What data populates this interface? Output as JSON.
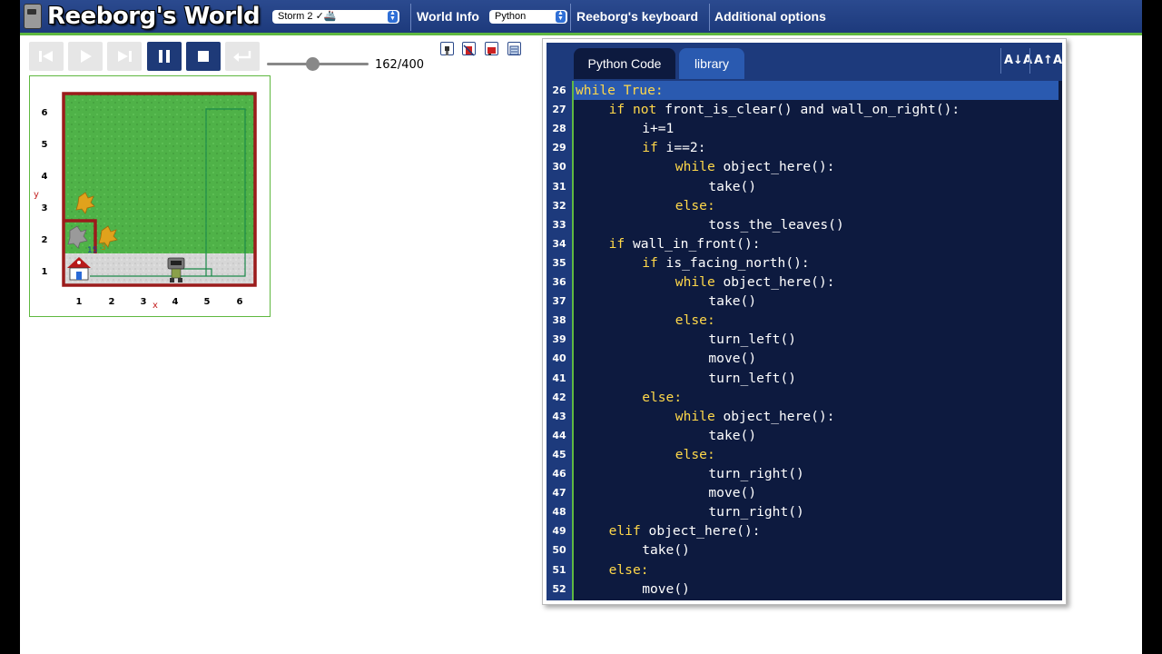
{
  "header": {
    "app_title": "Reeborg's World",
    "world_select": "Storm 2 ✓🚢",
    "world_info": "World Info",
    "language_select": "Python",
    "keyboard": "Reeborg's keyboard",
    "additional": "Additional options"
  },
  "controls": {
    "reverse_step": "reverse-step-icon",
    "run": "play-icon",
    "step": "step-icon",
    "pause": "pause-icon",
    "stop": "stop-icon",
    "reload": "reload-icon",
    "speed_percent": 45,
    "steps": "162/400",
    "toolbar_icons": [
      "robot-model-icon",
      "highlight-toggle-icon",
      "watch-variables-icon",
      "world-editor-icon"
    ]
  },
  "world": {
    "x_ticks": [
      "1",
      "2",
      "3",
      "4",
      "5",
      "6"
    ],
    "y_ticks": [
      "1",
      "2",
      "3",
      "4",
      "5",
      "6"
    ],
    "x_label": "x",
    "y_label": "y",
    "colors": {
      "wall": "#9b1b1b",
      "grass": "#4fb248",
      "trace": "#1c8a4a"
    },
    "leaf_count_1": "15",
    "leaf_count_2": "3"
  },
  "editor": {
    "tabs": [
      "Python Code",
      "library"
    ],
    "font_decrease": "A↓A",
    "font_increase": "A↑A",
    "highlight_line": 26,
    "lines": [
      {
        "n": "26",
        "indent": 0,
        "kw": "while True:",
        "rest": ""
      },
      {
        "n": "27",
        "indent": 1,
        "kw": "if not",
        "rest": " front_is_clear() and wall_on_right():"
      },
      {
        "n": "28",
        "indent": 2,
        "kw": "",
        "rest": "i+=1"
      },
      {
        "n": "29",
        "indent": 2,
        "kw": "if",
        "rest": " i==2:"
      },
      {
        "n": "30",
        "indent": 3,
        "kw": "while",
        "rest": " object_here():"
      },
      {
        "n": "31",
        "indent": 4,
        "kw": "",
        "rest": "take()"
      },
      {
        "n": "32",
        "indent": 3,
        "kw": "else:",
        "rest": ""
      },
      {
        "n": "33",
        "indent": 4,
        "kw": "",
        "rest": "toss_the_leaves()"
      },
      {
        "n": "34",
        "indent": 1,
        "kw": "if",
        "rest": " wall_in_front():"
      },
      {
        "n": "35",
        "indent": 2,
        "kw": "if",
        "rest": " is_facing_north():"
      },
      {
        "n": "36",
        "indent": 3,
        "kw": "while",
        "rest": " object_here():"
      },
      {
        "n": "37",
        "indent": 4,
        "kw": "",
        "rest": "take()"
      },
      {
        "n": "38",
        "indent": 3,
        "kw": "else:",
        "rest": ""
      },
      {
        "n": "39",
        "indent": 4,
        "kw": "",
        "rest": "turn_left()"
      },
      {
        "n": "40",
        "indent": 4,
        "kw": "",
        "rest": "move()"
      },
      {
        "n": "41",
        "indent": 4,
        "kw": "",
        "rest": "turn_left()"
      },
      {
        "n": "42",
        "indent": 2,
        "kw": "else:",
        "rest": ""
      },
      {
        "n": "43",
        "indent": 3,
        "kw": "while",
        "rest": " object_here():"
      },
      {
        "n": "44",
        "indent": 4,
        "kw": "",
        "rest": "take()"
      },
      {
        "n": "45",
        "indent": 3,
        "kw": "else:",
        "rest": ""
      },
      {
        "n": "46",
        "indent": 4,
        "kw": "",
        "rest": "turn_right()"
      },
      {
        "n": "47",
        "indent": 4,
        "kw": "",
        "rest": "move()"
      },
      {
        "n": "48",
        "indent": 4,
        "kw": "",
        "rest": "turn_right()"
      },
      {
        "n": "49",
        "indent": 1,
        "kw": "elif",
        "rest": " object_here():"
      },
      {
        "n": "50",
        "indent": 2,
        "kw": "",
        "rest": "take()"
      },
      {
        "n": "51",
        "indent": 1,
        "kw": "else:",
        "rest": ""
      },
      {
        "n": "52",
        "indent": 2,
        "kw": "",
        "rest": "move()"
      }
    ]
  }
}
